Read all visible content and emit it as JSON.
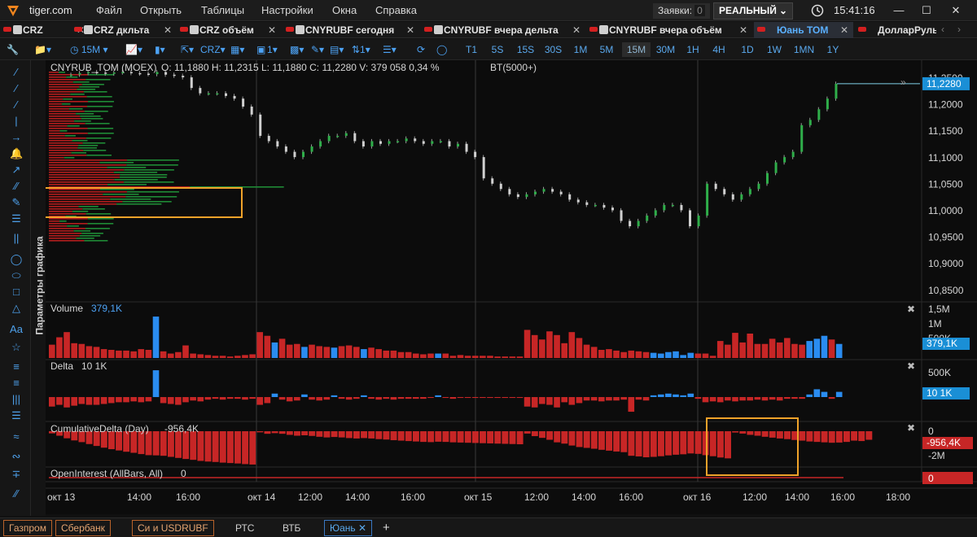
{
  "app": {
    "brand": "tiger.com"
  },
  "menu": [
    "Файл",
    "Открыть",
    "Таблицы",
    "Настройки",
    "Окна",
    "Справка"
  ],
  "orders": {
    "label": "Заявки:",
    "count": "0"
  },
  "account": {
    "mode": "РЕАЛЬНЫЙ"
  },
  "clock": "15:41:16",
  "tabs": [
    {
      "label": "CRZ"
    },
    {
      "label": "CRZ дкльта"
    },
    {
      "label": "CRZ объём"
    },
    {
      "label": "CNYRUBF сегодня"
    },
    {
      "label": "CNYRUBF вчера дельта"
    },
    {
      "label": "CNYRUBF вчера объём"
    },
    {
      "label": "Юань ТОМ"
    },
    {
      "label": "ДолларРуль"
    }
  ],
  "toolbar": {
    "interval": "15M",
    "count": "1",
    "timeframes": [
      "T1",
      "5S",
      "15S",
      "30S",
      "1M",
      "5M",
      "15M",
      "30M",
      "1H",
      "4H",
      "1D",
      "1W",
      "1MN",
      "1Y"
    ],
    "selected_tf": "15M"
  },
  "side_label": "Параметры графика",
  "chart": {
    "instrument_header": "CNYRUB_TOM (MOEX)",
    "ohlc": "O: 11,1880  H: 11,2315  L: 11,1880  C: 11,2280  V: 379 058  0,34 %",
    "profile": "BT(5000+)",
    "last_price": "11,2280",
    "price_ticks": [
      "11,2500",
      "11,2000",
      "11,1500",
      "11,1000",
      "11,0500",
      "11,0000",
      "10,9500",
      "10,9000",
      "10,8500"
    ],
    "volume": {
      "title": "Volume",
      "value": "379,1K",
      "ticks": [
        "1,5M",
        "1M",
        "500K"
      ],
      "badge": "379,1K"
    },
    "delta": {
      "title": "Delta",
      "value": "10 1K",
      "ticks": [
        "500K"
      ],
      "badge": "10 1K"
    },
    "cumdelta": {
      "title": "CumulativeDelta (Day)",
      "value": "-956,4K",
      "ticks": [
        "0",
        "-2M"
      ],
      "badge": "-956,4K"
    },
    "oi": {
      "title": "OpenInterest (AllBars, All)",
      "value": "0",
      "badge": "0"
    },
    "time_labels": [
      "окт 13",
      "14:00",
      "16:00",
      "окт 14",
      "12:00",
      "14:00",
      "16:00",
      "окт 15",
      "12:00",
      "14:00",
      "16:00",
      "окт 16",
      "12:00",
      "14:00",
      "16:00",
      "18:00"
    ]
  },
  "chart_data": {
    "type": "candlestick",
    "y_range": [
      10.83,
      11.26
    ],
    "sessions": [
      "окт 13",
      "окт 14",
      "окт 15",
      "окт 16"
    ],
    "last_close": 11.228,
    "price_path": [
      11.245,
      11.248,
      11.25,
      11.249,
      11.247,
      11.249,
      11.25,
      11.248,
      11.247,
      11.246,
      11.25,
      11.245,
      11.243,
      11.24,
      11.22,
      11.21,
      11.21,
      11.21,
      11.205,
      11.2,
      11.185,
      11.17,
      11.13,
      11.12,
      11.11,
      11.1,
      11.09,
      11.1,
      11.11,
      11.12,
      11.13,
      11.13,
      11.135,
      11.12,
      11.11,
      11.12,
      11.115,
      11.12,
      11.12,
      11.125,
      11.12,
      11.115,
      11.12,
      11.12,
      11.11,
      11.115,
      11.1,
      11.09,
      11.05,
      11.04,
      11.03,
      11.02,
      11.015,
      11.02,
      11.025,
      11.03,
      11.025,
      11.02,
      11.01,
      11.005,
      11.0,
      11.0,
      10.995,
      10.99,
      10.97,
      10.96,
      10.97,
      10.98,
      10.99,
      11.0,
      11.0,
      10.99,
      10.96,
      10.98,
      11.04,
      11.03,
      11.02,
      11.01,
      11.02,
      11.03,
      11.04,
      11.06,
      11.08,
      11.09,
      11.1,
      11.15,
      11.16,
      11.18,
      11.2,
      11.228
    ],
    "volume": [
      180,
      280,
      350,
      200,
      190,
      160,
      150,
      120,
      110,
      100,
      100,
      90,
      120,
      110,
      560,
      90,
      60,
      80,
      170,
      60,
      50,
      40,
      30,
      30,
      20,
      30,
      40,
      50,
      350,
      300,
      210,
      260,
      180,
      190,
      150,
      180,
      160,
      150,
      140,
      160,
      170,
      150,
      120,
      140,
      120,
      100,
      100,
      80,
      80,
      60,
      50,
      60,
      60,
      60,
      30,
      40,
      30,
      30,
      30,
      30,
      20,
      20,
      20,
      20,
      380,
      310,
      250,
      360,
      310,
      200,
      350,
      270,
      180,
      150,
      110,
      120,
      100,
      80,
      100,
      90,
      80,
      70,
      60,
      80,
      90,
      40,
      70,
      60,
      60,
      30,
      230,
      180,
      340,
      210,
      330,
      190,
      190,
      260,
      210,
      270,
      190,
      180,
      230,
      260,
      300,
      250,
      190
    ],
    "delta": [
      -110,
      -90,
      -120,
      -100,
      -80,
      -90,
      -90,
      -80,
      -70,
      -60,
      -60,
      -50,
      -60,
      -50,
      310,
      -70,
      -80,
      -90,
      -60,
      -40,
      -50,
      -30,
      -20,
      -30,
      -20,
      -20,
      -30,
      -20,
      -90,
      -70,
      40,
      -30,
      -50,
      -40,
      30,
      -30,
      -40,
      -30,
      20,
      -20,
      -30,
      -20,
      20,
      -20,
      -30,
      -20,
      -30,
      -20,
      -20,
      -20,
      -20,
      -10,
      20,
      -10,
      -20,
      -10,
      -10,
      -10,
      -10,
      -10,
      -10,
      -10,
      -10,
      -10,
      -110,
      -120,
      -80,
      -90,
      -120,
      -60,
      -90,
      -70,
      -40,
      -40,
      -50,
      -40,
      -40,
      -30,
      -170,
      -30,
      -40,
      20,
      30,
      40,
      30,
      20,
      40,
      -20,
      -60,
      -50,
      -60,
      -40,
      -50,
      -40,
      -40,
      -30,
      -40,
      -30,
      -40,
      -20,
      -20,
      -20,
      30,
      90,
      60,
      -20,
      60
    ],
    "cumulative_delta": [
      -100,
      -210,
      -330,
      -430,
      -510,
      -600,
      -690,
      -770,
      -840,
      -900,
      -960,
      -1010,
      -1070,
      -1120,
      -1130,
      -1150,
      -1200,
      -1250,
      -1300,
      -1340,
      -1390,
      -1420,
      -1440,
      -1470,
      -1490,
      -1510,
      -1540,
      -1560,
      -50,
      -120,
      -90,
      -120,
      -170,
      -210,
      -190,
      -220,
      -260,
      -290,
      -270,
      -290,
      -320,
      -340,
      -320,
      -340,
      -370,
      -390,
      -420,
      -440,
      -460,
      -480,
      -500,
      -510,
      -490,
      -500,
      -520,
      -530,
      -540,
      -550,
      -560,
      -570,
      -580,
      -590,
      -600,
      -610,
      -110,
      -230,
      -310,
      -400,
      -520,
      -580,
      -670,
      -740,
      -780,
      -820,
      -870,
      -910,
      -950,
      -980,
      -1150,
      -1180,
      -1220,
      -1200,
      -1170,
      -1130,
      -1100,
      -1080,
      -1040,
      -1060,
      -1120,
      -1170,
      -1230,
      -1270,
      -60,
      -110,
      -170,
      -210,
      -260,
      -300,
      -340,
      -370,
      -410,
      -440,
      -480,
      -500,
      -520,
      -540,
      -530,
      -500,
      -440,
      -460,
      -400
    ]
  }
}
